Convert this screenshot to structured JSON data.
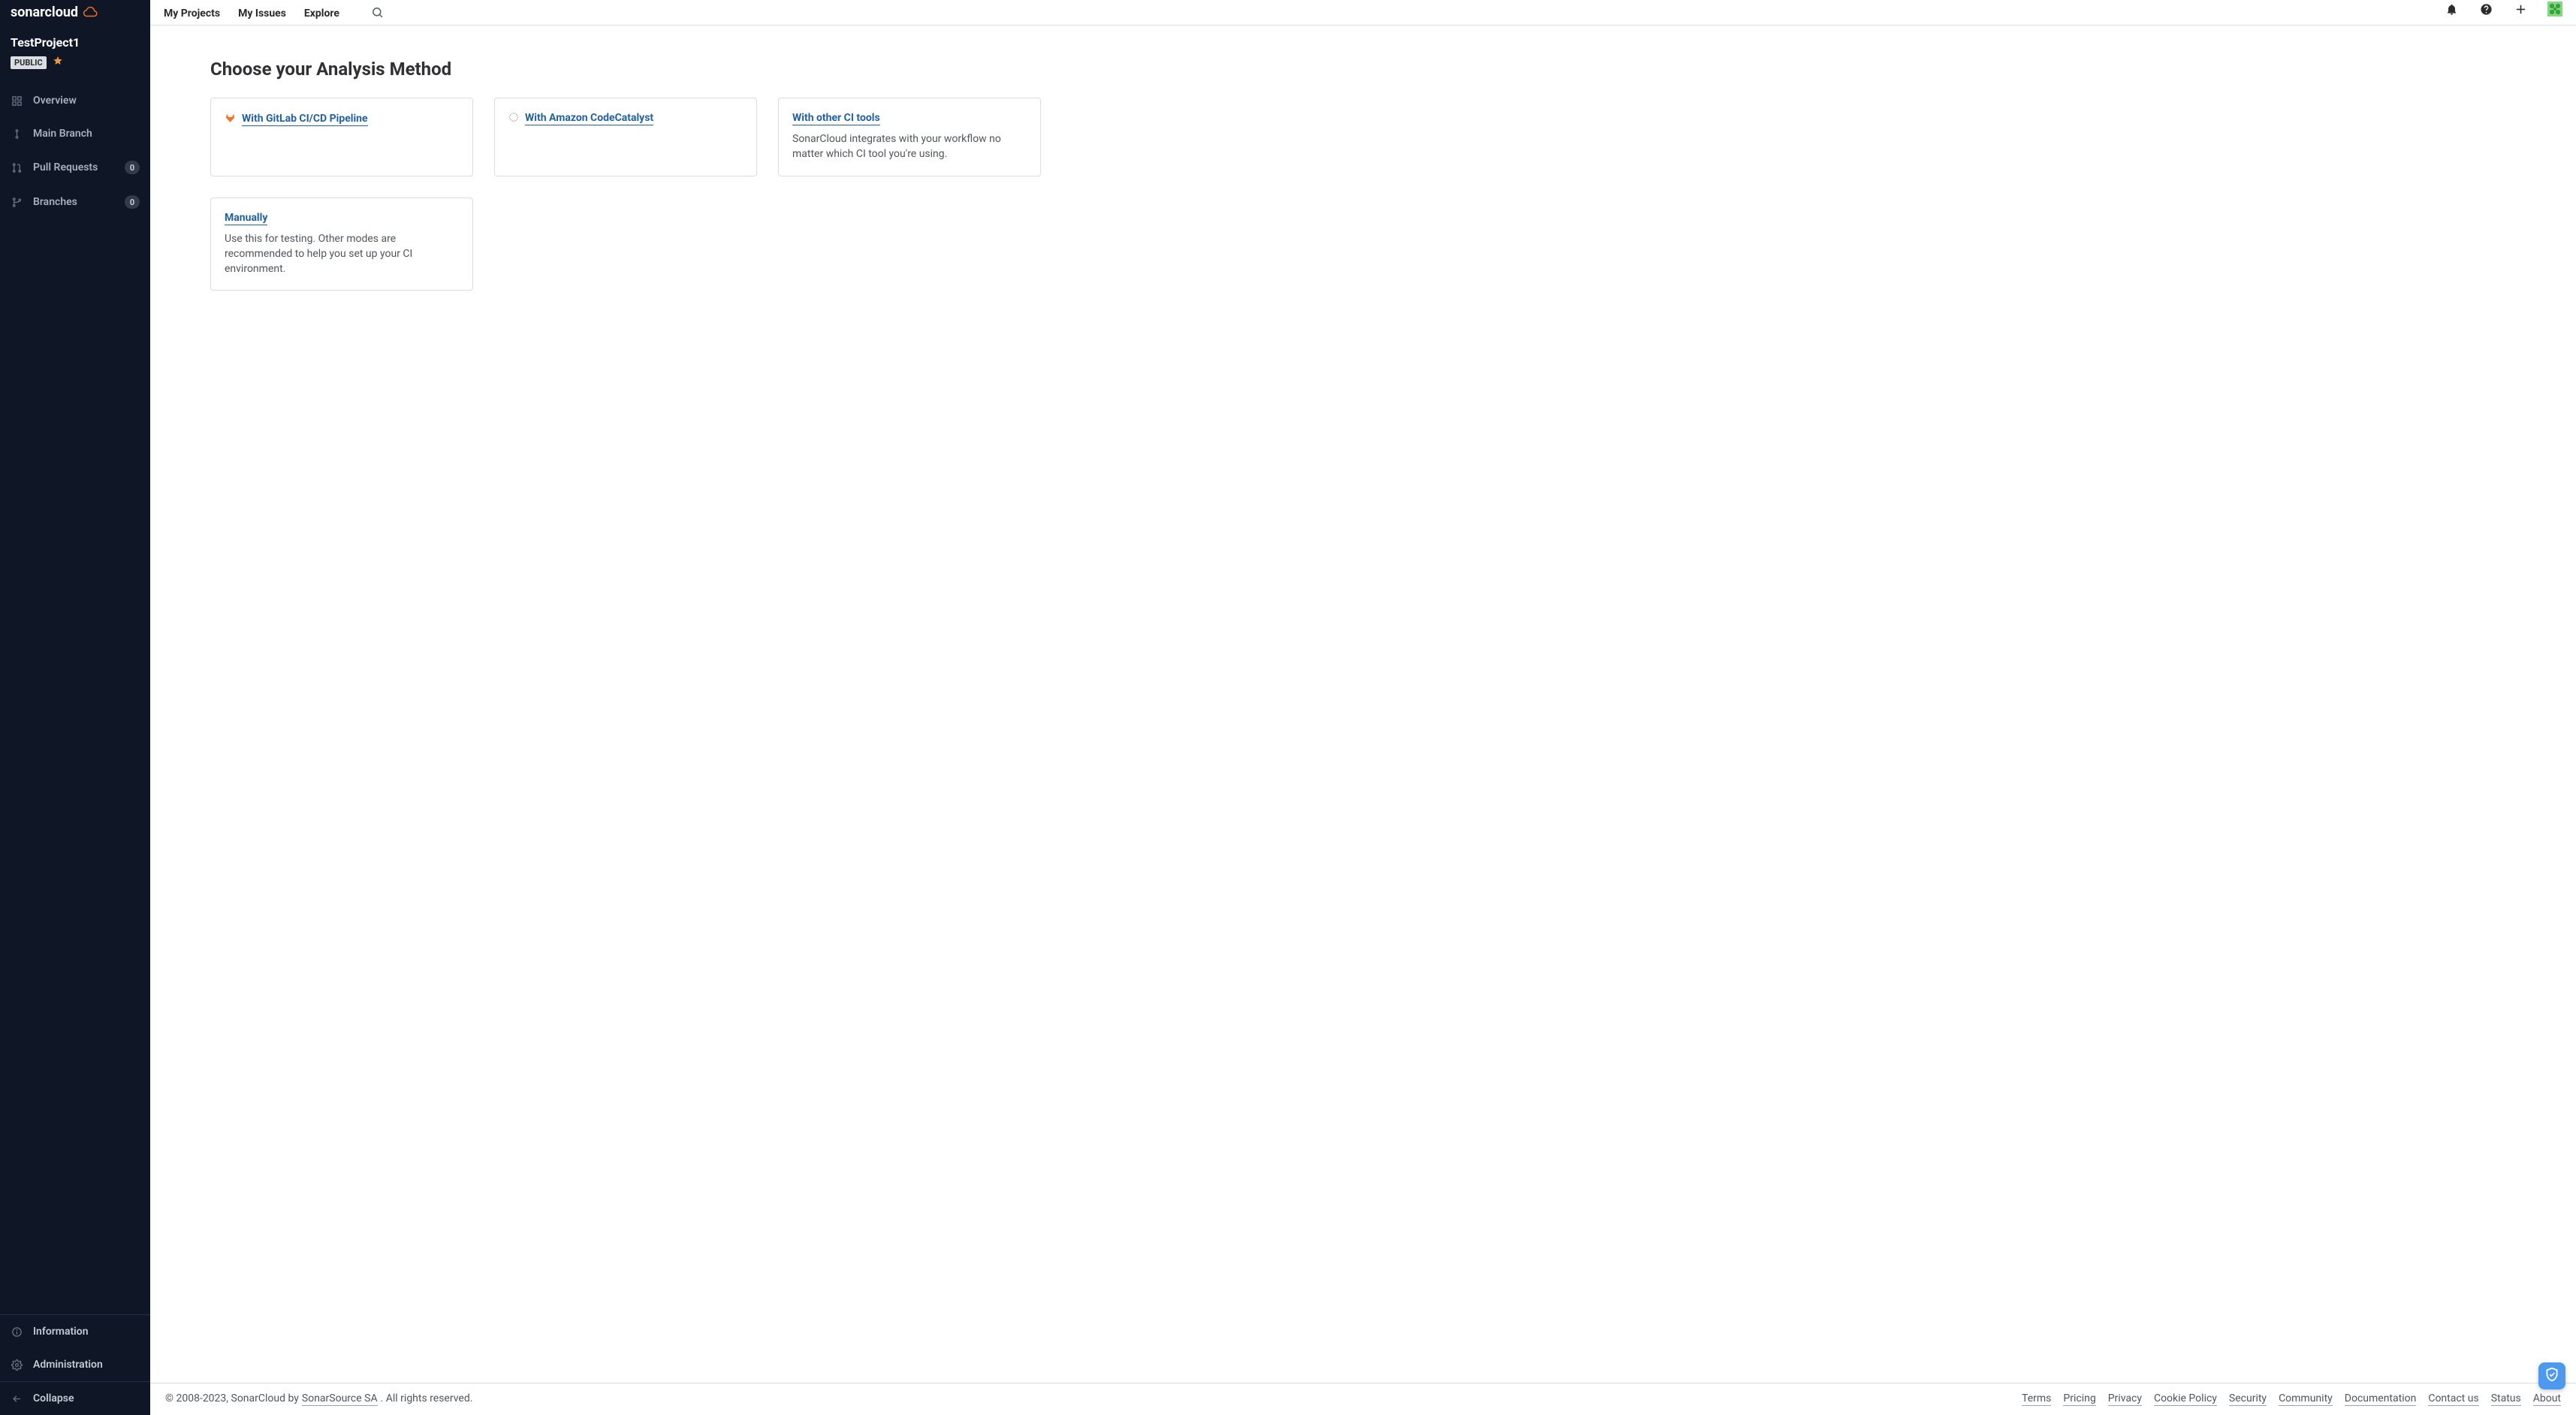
{
  "brand": {
    "name": "sonarcloud"
  },
  "topnav": {
    "projects": "My Projects",
    "issues": "My Issues",
    "explore": "Explore"
  },
  "sidebar": {
    "project_name": "TestProject1",
    "visibility": "PUBLIC",
    "items": [
      {
        "label": "Overview"
      },
      {
        "label": "Main Branch"
      },
      {
        "label": "Pull Requests",
        "count": "0"
      },
      {
        "label": "Branches",
        "count": "0"
      }
    ],
    "information": "Information",
    "administration": "Administration",
    "collapse": "Collapse"
  },
  "page": {
    "title": "Choose your Analysis Method"
  },
  "cards": {
    "gitlab": {
      "label": "With GitLab CI/CD Pipeline"
    },
    "aws": {
      "label": "With Amazon CodeCatalyst"
    },
    "other": {
      "label": "With other CI tools",
      "desc": "SonarCloud integrates with your workflow no matter which CI tool you're using."
    },
    "manual": {
      "label": "Manually",
      "desc": "Use this for testing. Other modes are recommended to help you set up your CI environment."
    }
  },
  "footer": {
    "copyright_prefix": "© 2008-2023, SonarCloud by ",
    "company": "SonarSource SA",
    "copyright_suffix": ". All rights reserved.",
    "links": {
      "terms": "Terms",
      "pricing": "Pricing",
      "privacy": "Privacy",
      "cookie": "Cookie Policy",
      "security": "Security",
      "community": "Community",
      "docs": "Documentation",
      "contact": "Contact us",
      "status": "Status",
      "about": "About"
    }
  }
}
